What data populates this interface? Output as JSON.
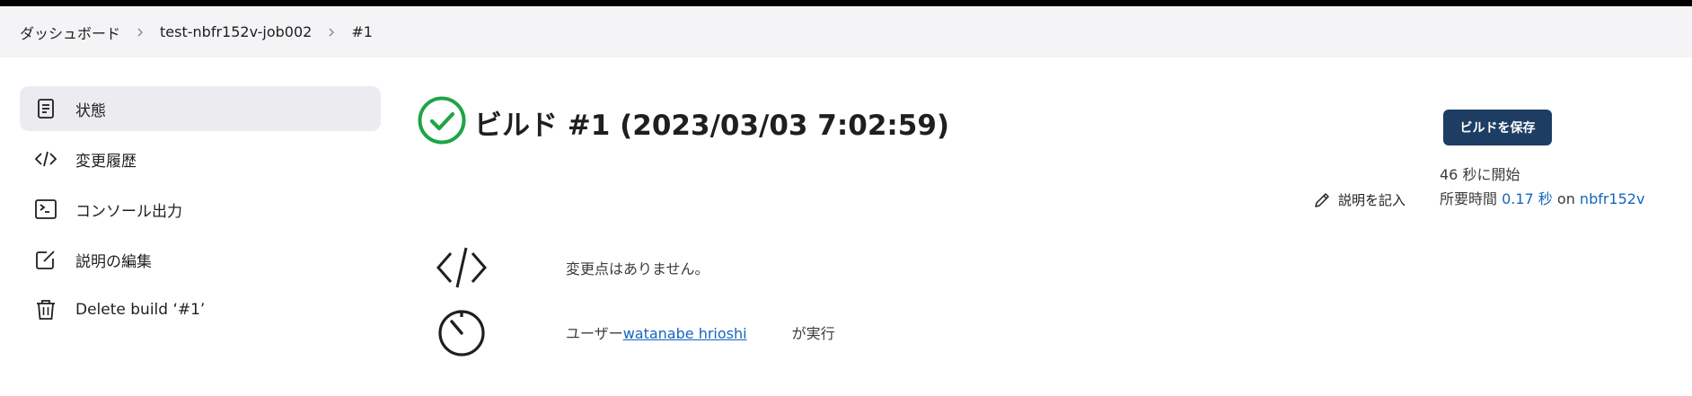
{
  "breadcrumb": {
    "items": [
      "ダッシュボード",
      "test-nbfr152v-job002",
      "#1"
    ]
  },
  "sidebar": {
    "items": [
      {
        "label": "状態",
        "icon": "document-icon",
        "active": true
      },
      {
        "label": "変更履歴",
        "icon": "code-icon"
      },
      {
        "label": "コンソール出力",
        "icon": "terminal-icon"
      },
      {
        "label": "説明の編集",
        "icon": "edit-icon"
      },
      {
        "label": "Delete build ‘#1’",
        "icon": "trash-icon"
      }
    ]
  },
  "build": {
    "title": "ビルド #1 (2023/03/03 7:02:59)",
    "status": "success",
    "status_color": "#1ea446",
    "save_button": "ビルドを保存",
    "started": "46 秒に開始",
    "duration_prefix": "所要時間 ",
    "duration": "0.17 秒",
    "on": " on ",
    "node": "nbfr152v",
    "add_description": "説明を記入"
  },
  "changes": {
    "text": "変更点はありません。"
  },
  "cause": {
    "prefix": "ユーザー",
    "user": "watanabe hrioshi",
    "suffix": "が実行"
  },
  "colors": {
    "accent": "#1e3d63",
    "link": "#1565c0",
    "success": "#1ea446"
  }
}
